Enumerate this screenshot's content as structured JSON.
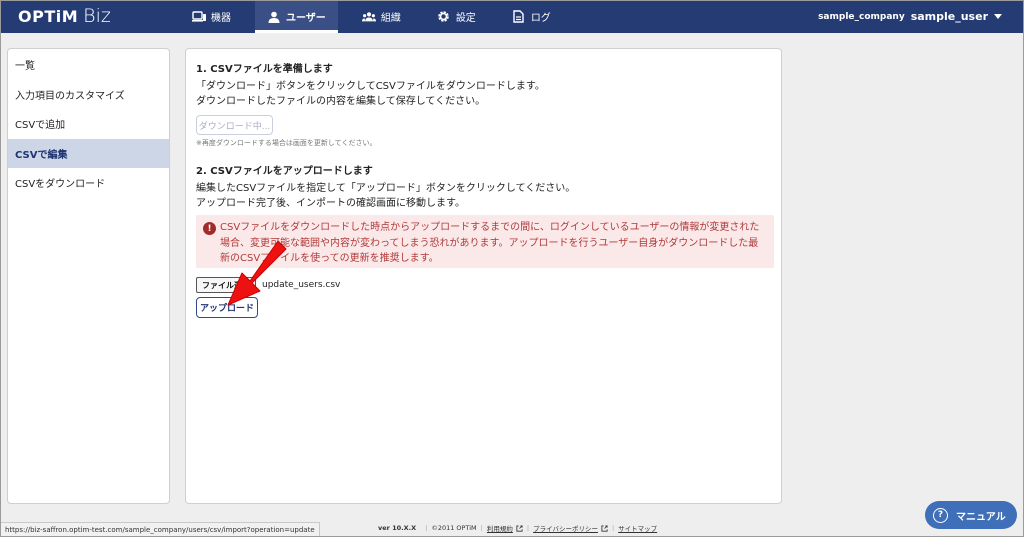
{
  "header": {
    "logo_main": "OPTiM",
    "logo_sub": "Biz",
    "nav": [
      {
        "label": "機器",
        "icon": "devices-icon"
      },
      {
        "label": "ユーザー",
        "icon": "user-icon",
        "active": true
      },
      {
        "label": "組織",
        "icon": "organization-icon"
      },
      {
        "label": "設定",
        "icon": "gear-icon"
      },
      {
        "label": "ログ",
        "icon": "log-document-icon"
      }
    ],
    "company": "sample_company",
    "user": "sample_user"
  },
  "sidebar": {
    "items": [
      {
        "label": "一覧"
      },
      {
        "label": "入力項目のカスタマイズ"
      },
      {
        "label": "CSVで追加"
      },
      {
        "label": "CSVで編集",
        "active": true
      },
      {
        "label": "CSVをダウンロード"
      }
    ]
  },
  "main": {
    "step1_title": "1. CSVファイルを準備します",
    "step1_line1": "「ダウンロード」ボタンをクリックしてCSVファイルをダウンロードします。",
    "step1_line2": "ダウンロードしたファイルの内容を編集して保存してください。",
    "download_button": "ダウンロード中...",
    "download_note": "※再度ダウンロードする場合は画面を更新してください。",
    "step2_title": "2. CSVファイルをアップロードします",
    "step2_line1": "編集したCSVファイルを指定して「アップロード」ボタンをクリックしてください。",
    "step2_line2": "アップロード完了後、インポートの確認画面に移動します。",
    "alert_text": "CSVファイルをダウンロードした時点からアップロードするまでの間に、ログインしているユーザーの情報が変更された場合、変更可能な範囲や内容が変わってしまう恐れがあります。アップロードを行うユーザー自身がダウンロードした最新のCSVファイルを使っての更新を推奨します。",
    "file_button": "ファイル選択",
    "file_name": "update_users.csv",
    "upload_button": "アップロード"
  },
  "footer": {
    "status_url": "https://biz-saffron.optim-test.com/sample_company/users/csv/import?operation=update",
    "version": "ver 10.X.X",
    "copyright": "©2011 OPTiM",
    "terms": "利用規約",
    "privacy": "プライバシーポリシー",
    "sitemap": "サイトマップ",
    "manual": "マニュアル"
  },
  "colors": {
    "header_bg": "#243b73",
    "sidebar_active_bg": "#cdd6e7",
    "alert_bg": "#fbe9e9",
    "alert_text": "#b03a3a",
    "arrow": "#ee1111",
    "manual_bg": "#3f6fb8"
  }
}
